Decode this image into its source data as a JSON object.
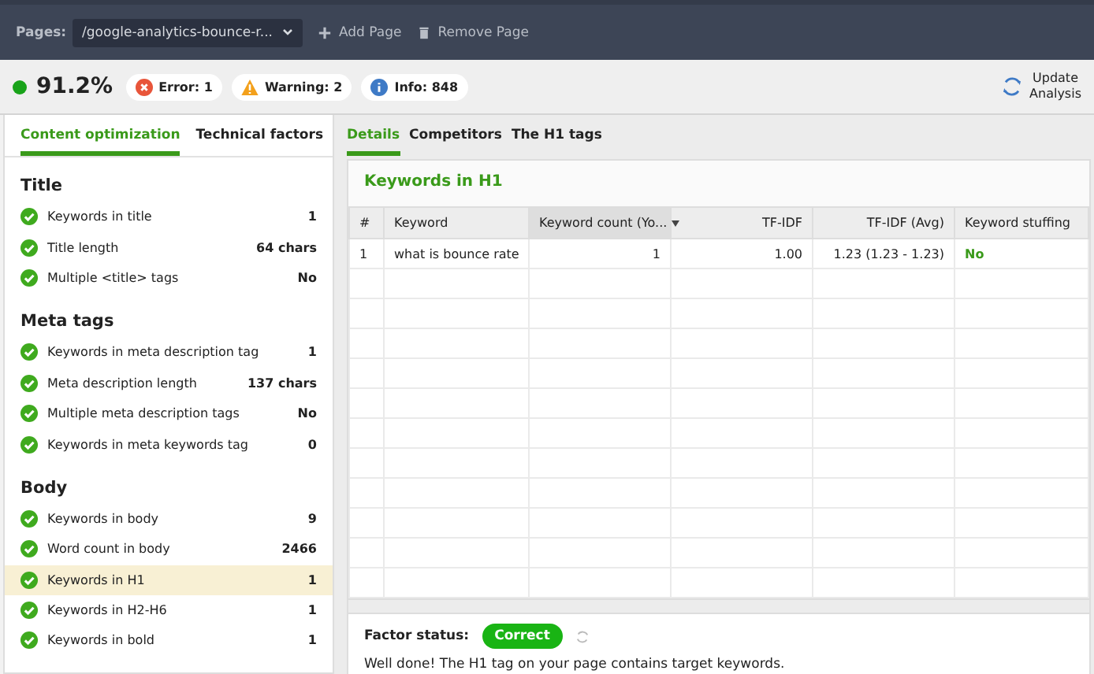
{
  "topbar": {
    "pages_label": "Pages:",
    "page_select": "/google-analytics-bounce-r...",
    "actions": [
      {
        "kind": "add",
        "label": "Add Page"
      },
      {
        "kind": "remove",
        "label": "Remove Page"
      }
    ]
  },
  "summary": {
    "score": "91.2%",
    "badges": [
      {
        "kind": "error",
        "label": "Error: 1"
      },
      {
        "kind": "warning",
        "label": "Warning: 2"
      },
      {
        "kind": "info",
        "label": "Info: 848"
      }
    ],
    "update": [
      "Update",
      "Analysis"
    ]
  },
  "sidebar": {
    "tabs": [
      {
        "label": "Content optimization",
        "selected": true
      },
      {
        "label": "Technical factors",
        "selected": false
      }
    ],
    "sections": [
      {
        "title": "Title",
        "items": [
          {
            "label": "Keywords in title",
            "value": "1",
            "selected": false
          },
          {
            "label": "Title length",
            "value": "64 chars",
            "selected": false
          },
          {
            "label": "Multiple <title> tags",
            "value": "No",
            "selected": false
          }
        ]
      },
      {
        "title": "Meta tags",
        "items": [
          {
            "label": "Keywords in meta description tag",
            "value": "1",
            "selected": false
          },
          {
            "label": "Meta description length",
            "value": "137 chars",
            "selected": false
          },
          {
            "label": "Multiple meta description tags",
            "value": "No",
            "selected": false
          },
          {
            "label": "Keywords in meta keywords tag",
            "value": "0",
            "selected": false
          }
        ]
      },
      {
        "title": "Body",
        "items": [
          {
            "label": "Keywords in body",
            "value": "9",
            "selected": false
          },
          {
            "label": "Word count in body",
            "value": "2466",
            "selected": false
          },
          {
            "label": "Keywords in H1",
            "value": "1",
            "selected": true
          },
          {
            "label": "Keywords in H2-H6",
            "value": "1",
            "selected": false
          },
          {
            "label": "Keywords in bold",
            "value": "1",
            "selected": false
          }
        ]
      }
    ]
  },
  "details": {
    "tabs": [
      {
        "label": "Details",
        "selected": true
      },
      {
        "label": "Competitors",
        "selected": false
      },
      {
        "label": "The H1 tags",
        "selected": false
      }
    ],
    "title": "Keywords in H1",
    "table": {
      "columns": [
        {
          "label": "#",
          "sorted": false
        },
        {
          "label": "Keyword",
          "sorted": false
        },
        {
          "label": "Keyword count (Yo...",
          "sorted": true
        },
        {
          "label": "TF-IDF",
          "sorted": false
        },
        {
          "label": "TF-IDF (Avg)",
          "sorted": false
        },
        {
          "label": "Keyword stuffing",
          "sorted": false
        }
      ],
      "rows": [
        [
          "1",
          "what is bounce rate",
          "1",
          "1.00",
          "1.23 (1.23 - 1.23)",
          "No"
        ]
      ]
    },
    "factor_status": {
      "label": "Factor status:",
      "status": "Correct",
      "message": "Well done! The H1 tag on your page contains target keywords."
    }
  }
}
